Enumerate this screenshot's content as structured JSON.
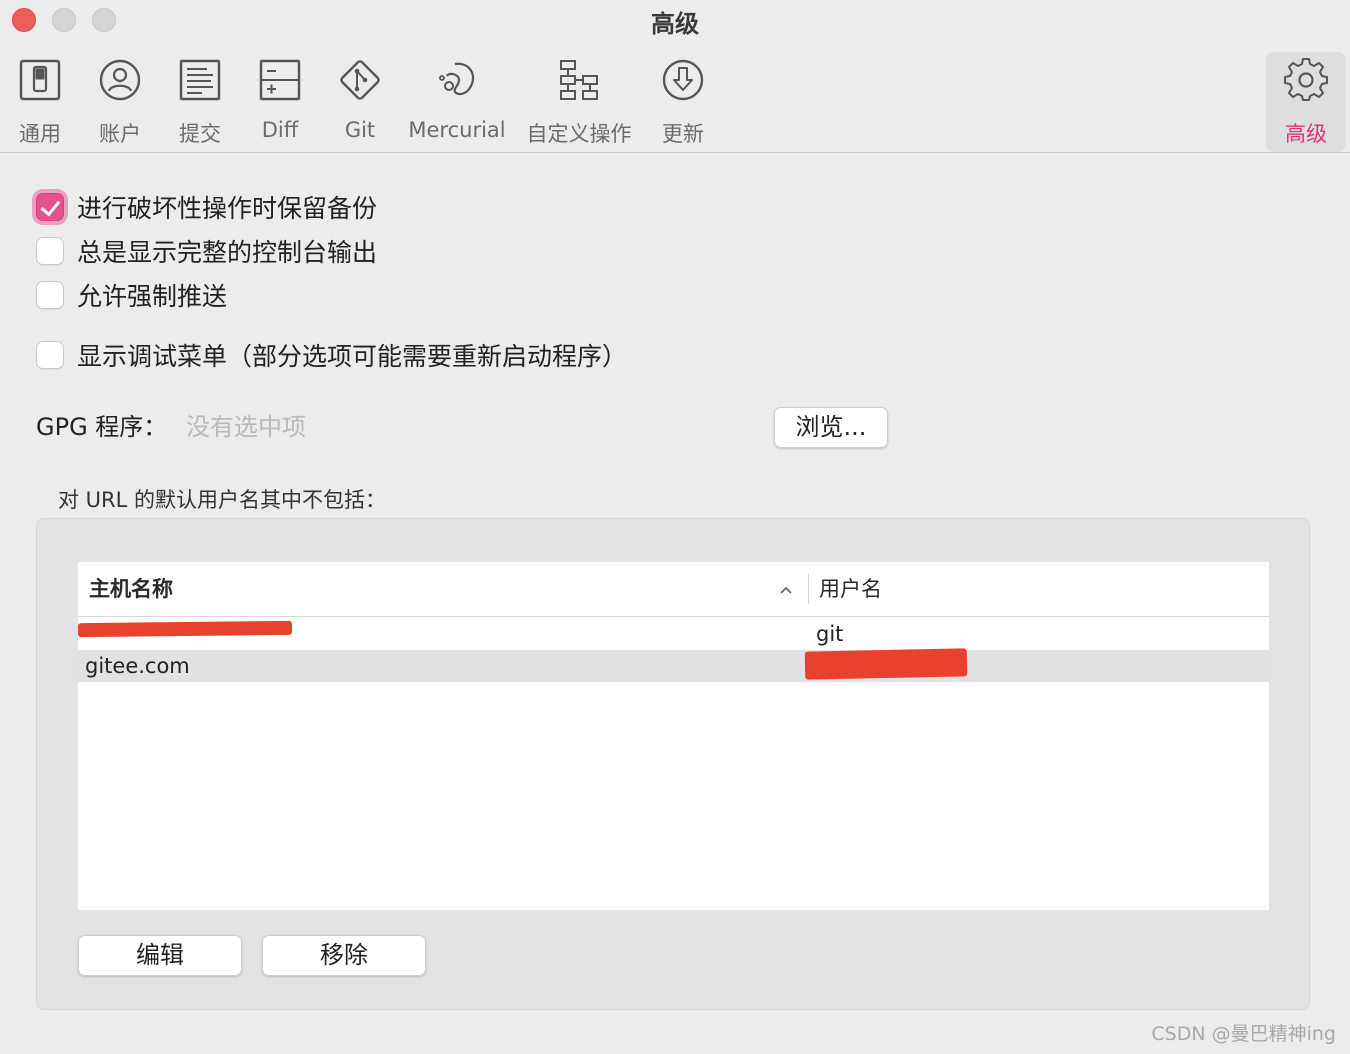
{
  "window": {
    "title": "高级"
  },
  "toolbar": {
    "items": [
      {
        "label": "通用",
        "icon": "general-switch-icon"
      },
      {
        "label": "账户",
        "icon": "account-person-icon"
      },
      {
        "label": "提交",
        "icon": "commit-document-icon"
      },
      {
        "label": "Diff",
        "icon": "diff-icon"
      },
      {
        "label": "Git",
        "icon": "git-icon"
      },
      {
        "label": "Mercurial",
        "icon": "mercurial-icon"
      },
      {
        "label": "自定义操作",
        "icon": "custom-actions-flow-icon"
      },
      {
        "label": "更新",
        "icon": "update-download-icon"
      },
      {
        "label": "高级",
        "icon": "gear-icon",
        "active": true
      }
    ],
    "active_color": "#e3307a"
  },
  "options": {
    "keep_backup": {
      "label": "进行破坏性操作时保留备份",
      "checked": true
    },
    "full_console": {
      "label": "总是显示完整的控制台输出",
      "checked": false
    },
    "force_push": {
      "label": "允许强制推送",
      "checked": false
    },
    "debug_menu": {
      "label": "显示调试菜单（部分选项可能需要重新启动程序）",
      "checked": false
    }
  },
  "gpg": {
    "label": "GPG 程序：",
    "placeholder": "没有选中项",
    "browse_label": "浏览..."
  },
  "url_users": {
    "heading": "对 URL 的默认用户名其中不包括：",
    "columns": {
      "host": "主机名称",
      "user": "用户名"
    },
    "rows": [
      {
        "host": "",
        "user": "git"
      },
      {
        "host": "gitee.com",
        "user": ""
      }
    ],
    "edit_label": "编辑",
    "remove_label": "移除"
  },
  "watermark": "CSDN @曼巴精神ing"
}
